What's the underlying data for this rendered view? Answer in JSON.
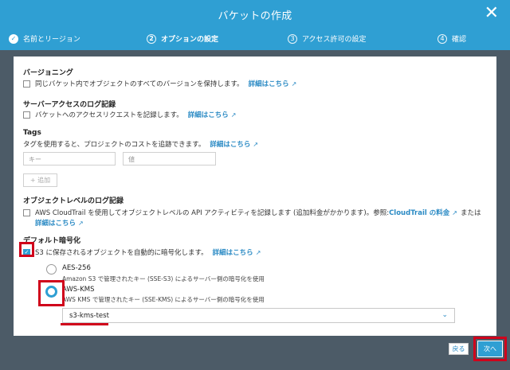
{
  "header": {
    "title": "バケットの作成",
    "close_icon": "close-icon"
  },
  "steps": [
    {
      "num": "✓",
      "label": "名前とリージョン",
      "state": "done"
    },
    {
      "num": "2",
      "label": "オプションの設定",
      "state": "active"
    },
    {
      "num": "3",
      "label": "アクセス許可の設定",
      "state": "pending"
    },
    {
      "num": "4",
      "label": "確認",
      "state": "pending"
    }
  ],
  "versioning": {
    "title": "バージョニング",
    "text": "同じバケット内でオブジェクトのすべてのバージョンを保持します。",
    "link": "詳細はこちら",
    "checked": false
  },
  "access_log": {
    "title": "サーバーアクセスのログ記録",
    "text": "バケットへのアクセスリクエストを記録します。",
    "link": "詳細はこちら",
    "checked": false
  },
  "tags": {
    "title": "Tags",
    "text": "タグを使用すると、プロジェクトのコストを追跡できます。",
    "link": "詳細はこちら",
    "key_placeholder": "キー",
    "value_placeholder": "値",
    "add_label": "+ 追加"
  },
  "object_log": {
    "title": "オブジェクトレベルのログ記録",
    "text1": "AWS CloudTrail を使用してオブジェクトレベルの API アクティビティを記録します (追加料金がかかります)。参照: ",
    "link1": "CloudTrail の料金",
    "text2": "または",
    "link2": "詳細はこちら",
    "checked": false
  },
  "encryption": {
    "title": "デフォルト暗号化",
    "text": "S3 に保存されるオブジェクトを自動的に暗号化します。",
    "link": "詳細はこちら",
    "checked": true,
    "options": [
      {
        "label": "AES-256",
        "desc": "Amazon S3 で管理されたキー (SSE-S3) によるサーバー側の暗号化を使用",
        "selected": false
      },
      {
        "label": "AWS-KMS",
        "desc": "AWS KMS で管理されたキー (SSE-KMS) によるサーバー側の暗号化を使用",
        "selected": true
      }
    ],
    "kms_key": "s3-kms-test"
  },
  "footer": {
    "back_label": "戻る",
    "next_label": "次へ"
  },
  "colors": {
    "primary": "#2f9fd3",
    "link": "#2a8ac4",
    "highlight": "#d0021b",
    "backdrop": "#4c5b67"
  }
}
